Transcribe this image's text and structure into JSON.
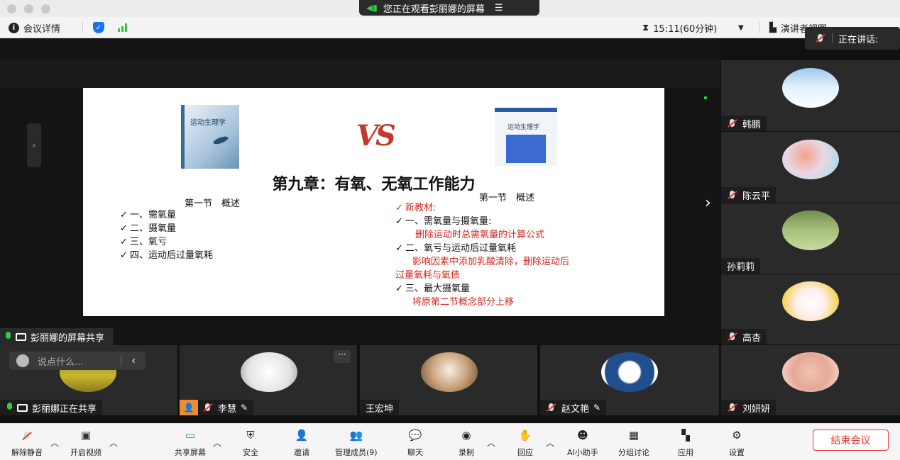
{
  "title_bar": {
    "viewing_text": "您正在观看彭丽娜的屏幕"
  },
  "info_bar": {
    "meeting_details": "会议详情",
    "timer": "15:11(60分钟)",
    "presenter_view": "演讲者视图"
  },
  "speaking_badge": {
    "label": "正在讲话:"
  },
  "share": {
    "label": "彭丽娜的屏幕共享",
    "slide": {
      "book_left_title": "运动生理学",
      "book_right_title": "运动生理学",
      "vs_text": "VS",
      "title": "第九章：有氧、无氧工作能力",
      "left_section": "第一节　概述",
      "right_section": "第一节　概述",
      "left_items": [
        "一、需氧量",
        "二、摄氧量",
        "三、氧亏",
        "四、运动后过量氧耗"
      ],
      "right_new_label": "新教材:",
      "right_item1": "一、需氧量与摄氧量:",
      "right_item1_note": "删除运动时总需氧量的计算公式",
      "right_item2": "二、氧亏与运动后过量氧耗",
      "right_item2_note_a": "影响因素中添加乳酸清除，删除运动后",
      "right_item2_note_b": "过量氧耗与氧债",
      "right_item3": "三、最大摄氧量",
      "right_item3_note": "将原第二节概念部分上移"
    }
  },
  "participants_right": [
    {
      "name": "韩鹏"
    },
    {
      "name": "陈云平"
    },
    {
      "name": "孙莉莉"
    },
    {
      "name": "高杏"
    },
    {
      "name": "刘妍妍"
    }
  ],
  "participants_bottom": [
    {
      "name": "彭丽娜正在共享"
    },
    {
      "name": "李慧"
    },
    {
      "name": "王宏坤"
    },
    {
      "name": "赵文艳"
    }
  ],
  "chat": {
    "placeholder": "说点什么..."
  },
  "toolbar": {
    "unmute": "解除静音",
    "start_video": "开启视频",
    "share_screen": "共享屏幕",
    "security": "安全",
    "invite": "邀请",
    "manage_members": "管理成员(9)",
    "chat": "聊天",
    "record": "录制",
    "react": "回应",
    "ai_assistant": "AI小助手",
    "breakout": "分组讨论",
    "apps": "应用",
    "settings": "设置",
    "end_meeting": "结束会议"
  },
  "colors": {
    "accent_green": "#2ecc40",
    "end_red": "#e53935",
    "slide_red": "#d4251c",
    "brand_blue": "#1a73e8"
  }
}
